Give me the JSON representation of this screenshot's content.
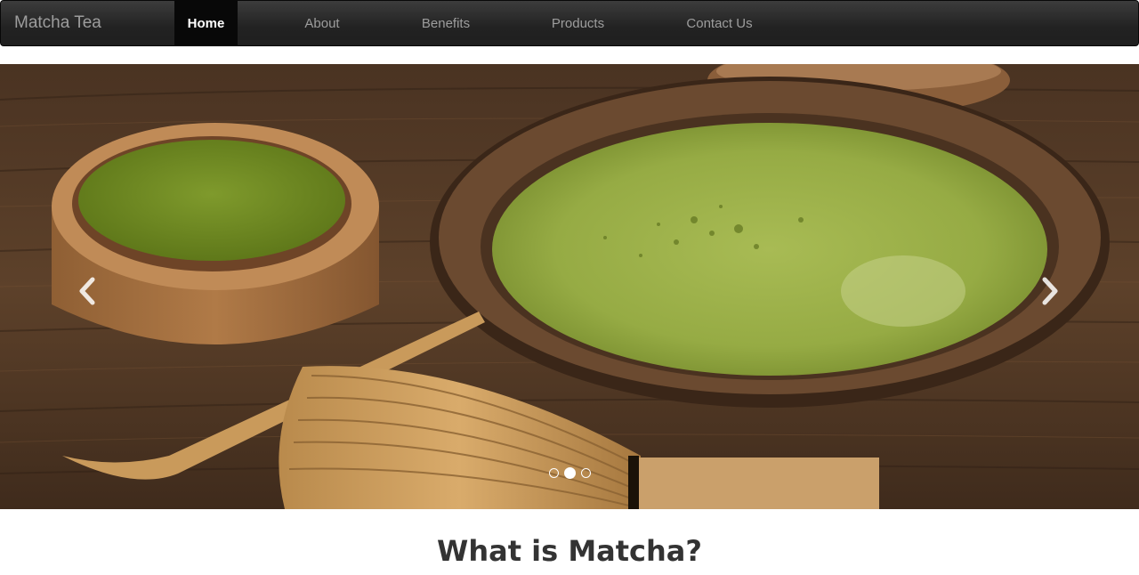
{
  "navbar": {
    "brand": "Matcha Tea",
    "items": [
      {
        "label": "Home",
        "active": true
      },
      {
        "label": "About",
        "active": false
      },
      {
        "label": "Benefits",
        "active": false
      },
      {
        "label": "Products",
        "active": false
      },
      {
        "label": "Contact Us",
        "active": false
      }
    ]
  },
  "carousel": {
    "slide_count": 3,
    "active_index": 1,
    "prev_icon": "chevron-left-icon",
    "next_icon": "chevron-right-icon"
  },
  "main": {
    "heading": "What is Matcha?"
  },
  "colors": {
    "navbar_bg": "#222222",
    "nav_text": "#9d9d9d",
    "nav_active_bg": "#080808",
    "matcha_green": "#8ea33c",
    "wood": "#5b3e27"
  }
}
